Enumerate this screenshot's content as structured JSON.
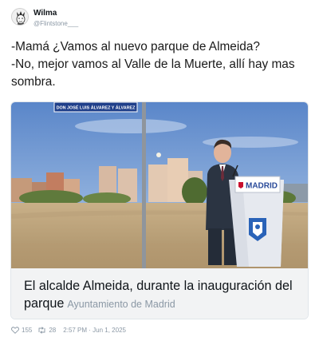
{
  "author": {
    "name": "Wilma",
    "handle": "@Flintstone___"
  },
  "tweet": {
    "lines": [
      "-Mamá ¿Vamos al nuevo parque de Almeida?",
      "-No, mejor vamos al Valle de la Muerte, allí hay mas",
      "sombra."
    ]
  },
  "card": {
    "caption": "El alcalde Almeida, durante la inauguración del parque",
    "source": "Ayuntamiento de Madrid",
    "street_sign": "DON JOSÉ LUIS ÁLVAREZ Y ÁLVAREZ",
    "podium_label": "MADRID"
  },
  "footer": {
    "likes": "155",
    "retweets": "28",
    "timestamp": "2:57 PM · Jun 1, 2025"
  },
  "icons": {
    "avatar": "avatar-icon",
    "like": "heart-icon",
    "retweet": "retweet-icon"
  }
}
